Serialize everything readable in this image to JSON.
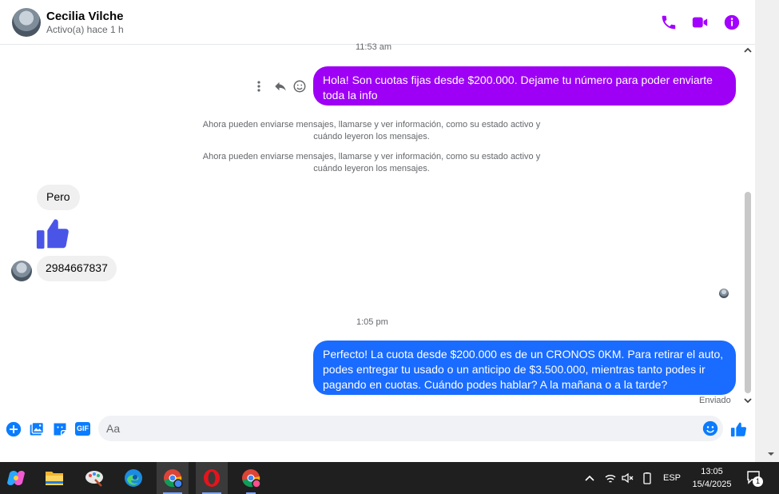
{
  "contact": {
    "name": "Cecilia Vilche",
    "status": "Activo(a) hace 1 h"
  },
  "header_icons": [
    "phone-icon",
    "video-call-icon",
    "info-icon"
  ],
  "colors": {
    "accent": "#a200ff",
    "sent_purple": "#9d00f5",
    "sent_blue": "#1a6bff",
    "received": "#f0f0f0",
    "like_blue": "#0a7cff"
  },
  "chat": {
    "time_1": "11:53 am",
    "msg_sent_1": "Hola! Son cuotas fijas desde $200.000. Dejame tu número para poder enviarte toda la info",
    "system_msg_1": "Ahora pueden enviarse mensajes, llamarse y ver información, como su estado activo y cuándo leyeron los mensajes.",
    "system_msg_2": "Ahora pueden enviarse mensajes, llamarse y ver información, como su estado activo y cuándo leyeron los mensajes.",
    "msg_recv_1": "Pero",
    "msg_recv_2": "2984667837",
    "time_2": "1:05 pm",
    "msg_sent_2": "Perfecto! La cuota desde $200.000 es de un CRONOS 0KM. Para retirar el auto, podes entregar tu usado o un anticipo de $3.500.000, mientras tanto podes ir pagando en cuotas. Cuándo podes hablar? A la mañana o a la tarde?",
    "delivery_status": "Enviado"
  },
  "composer": {
    "placeholder": "Aa",
    "icons": [
      "plus-icon",
      "gallery-icon",
      "sticker-icon",
      "gif-icon",
      "emoji-icon",
      "like-icon"
    ],
    "gif_label": "GIF"
  },
  "taskbar": {
    "apps": [
      "copilot-icon",
      "file-explorer-icon",
      "paint-icon",
      "edge-icon",
      "chrome-icon",
      "opera-icon",
      "chrome-profile-icon"
    ],
    "language": "ESP",
    "time": "13:05",
    "date": "15/4/2025",
    "notification_count": "1"
  }
}
